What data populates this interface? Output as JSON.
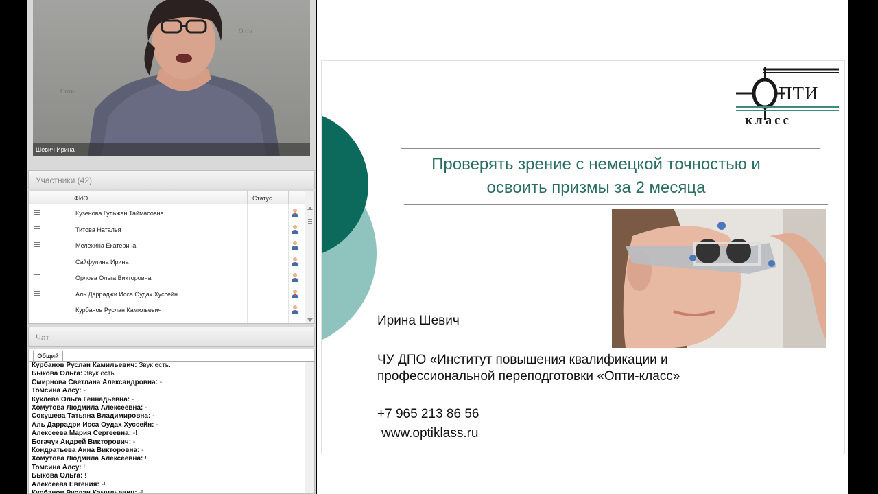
{
  "video": {
    "caption": "Шевич Ирина",
    "wall_logo": "Опти"
  },
  "participants": {
    "header": "Участники (42)",
    "columns": {
      "name": "ФИО",
      "status": "Статус"
    },
    "rows": [
      "Кузенова Гульжан Таймасовна",
      "Титова Наталья",
      "Мелехина Екатерина",
      "Сайфулина Ирина",
      "Орлова Ольга Викторовна",
      "Аль Дарраджи  Исса  Оудах Хуссейн",
      "Курбанов Руслан Камильевич"
    ]
  },
  "chat": {
    "header": "Чат",
    "tab": "Общий",
    "messages": [
      {
        "author": "Курбанов Руслан Камильевич:",
        "text": " Звук есть."
      },
      {
        "author": "Быкова Ольга:",
        "text": " Звук есть"
      },
      {
        "author": "Смирнова Светлана Александровна:",
        "text": " -"
      },
      {
        "author": "Томсина Алсу:",
        "text": " -"
      },
      {
        "author": "Куклева Ольга Геннадьевна:",
        "text": " -"
      },
      {
        "author": "Хомутова Людмила Алексеевна:",
        "text": " -"
      },
      {
        "author": "Сокушева Татьяна Владимировна:",
        "text": " -"
      },
      {
        "author": "Аль Даррадри  Исса  Оудах Хуссейн:",
        "text": " -"
      },
      {
        "author": "Алексеева Мария Сергеевна:",
        "text": " -!"
      },
      {
        "author": "Богачук Андрей Викторович:",
        "text": " -"
      },
      {
        "author": "Кондратьева Анна Викторовна:",
        "text": " -"
      },
      {
        "author": "Хомутова Людмила Алексеевна:",
        "text": " !"
      },
      {
        "author": "Томсина Алсу:",
        "text": " !"
      },
      {
        "author": "Быкова Ольга:",
        "text": " !"
      },
      {
        "author": "Алексеева Евгения:",
        "text": " -!"
      },
      {
        "author": "Курбанов Руслан Камильевич:",
        "text": " -!"
      }
    ]
  },
  "slide": {
    "logo_text": "ПТИ",
    "logo_sub": "класс",
    "title_line1": "Проверять зрение с немецкой точностью и",
    "title_line2": "освоить призмы за 2 месяца",
    "speaker": "Ирина Шевич",
    "org_line1": "ЧУ ДПО «Институт повышения квалификации и",
    "org_line2": "профессиональной переподготовки «Опти-класс»",
    "phone": "+7 965 213 86 56",
    "website": "www.optiklass.ru",
    "title_color": "#2a6e63",
    "accent_dark": "#0b6a5c",
    "accent_light": "#8fc3bd"
  }
}
